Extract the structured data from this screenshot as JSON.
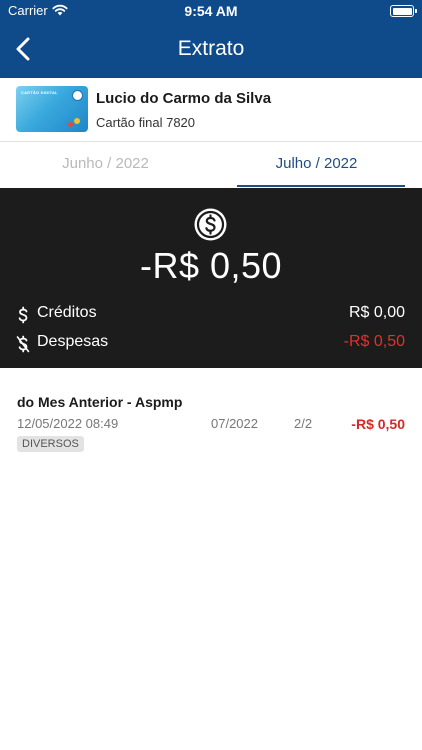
{
  "status_bar": {
    "carrier": "Carrier",
    "time": "9:54 AM"
  },
  "header": {
    "title": "Extrato",
    "back_icon": "chevron-left-icon",
    "background_color": "#0f4a8a"
  },
  "card": {
    "holder_name": "Lucio do Carmo da Silva",
    "subtitle": "Cartão final 7820",
    "thumbnail_label": "CARTÃO DIGITAL"
  },
  "tabs": [
    {
      "label": "Junho / 2022",
      "selected": false
    },
    {
      "label": "Julho / 2022",
      "selected": true
    }
  ],
  "summary": {
    "icon": "dollar-circle-icon",
    "balance": "-R$  0,50",
    "credits_label": "Créditos",
    "credits_value": "R$  0,00",
    "expenses_label": "Despesas",
    "expenses_value": "-R$  0,50",
    "negative_color": "#e0312c"
  },
  "transactions": [
    {
      "description": "do Mes Anterior - Aspmp",
      "datetime": "12/05/2022 08:49",
      "reference": "07/2022",
      "installment": "2/2",
      "amount": "-R$  0,50",
      "category": "DIVERSOS"
    }
  ]
}
